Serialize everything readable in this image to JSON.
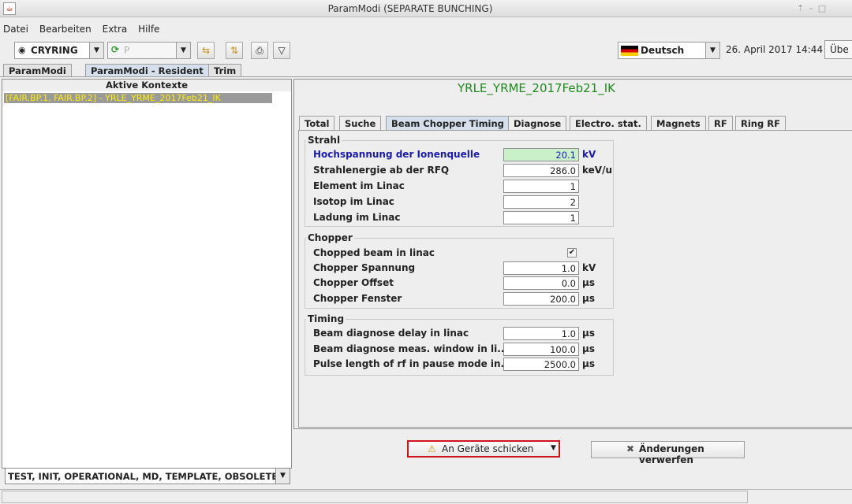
{
  "window": {
    "title": "ParamModi (SEPARATE BUNCHING)"
  },
  "menu": {
    "items": [
      "Datei",
      "Bearbeiten",
      "Extra",
      "Hilfe"
    ]
  },
  "toolbar": {
    "accelerator": "CRYRING",
    "particle": "P",
    "language": "Deutsch",
    "datetime": "26. April 2017 14:44",
    "mode_label": "Übe"
  },
  "main_tabs": [
    "ParamModi",
    "ParamModi - Resident",
    "Trim"
  ],
  "left": {
    "header": "Aktive Kontexte",
    "selected_context": "[FAIR.BP.1, FAIR.BP.2] - YRLE_YRME_2017Feb21_IK",
    "filter": "TEST, INIT, OPERATIONAL, MD, TEMPLATE, OBSOLETE"
  },
  "right": {
    "title": "YRLE_YRME_2017Feb21_IK",
    "tabs": [
      "Total",
      "Suche",
      "Beam Chopper Timing",
      "Diagnose",
      "Electro. stat.",
      "Magnets",
      "RF",
      "Ring RF"
    ],
    "groups": {
      "strahl": {
        "title": "Strahl",
        "fields": [
          {
            "label": "Hochspannung der Ionenquelle",
            "value": "20.1",
            "unit": "kV"
          },
          {
            "label": "Strahlenergie ab der RFQ",
            "value": "286.0",
            "unit": "keV/u"
          },
          {
            "label": "Element im Linac",
            "value": "1",
            "unit": ""
          },
          {
            "label": "Isotop im Linac",
            "value": "2",
            "unit": ""
          },
          {
            "label": "Ladung im Linac",
            "value": "1",
            "unit": ""
          }
        ]
      },
      "chopper": {
        "title": "Chopper",
        "checkbox_label": "Chopped beam in linac",
        "checked": true,
        "fields": [
          {
            "label": "Chopper Spannung",
            "value": "1.0",
            "unit": "kV"
          },
          {
            "label": "Chopper Offset",
            "value": "0.0",
            "unit": "µs"
          },
          {
            "label": "Chopper Fenster",
            "value": "200.0",
            "unit": "µs"
          }
        ]
      },
      "timing": {
        "title": "Timing",
        "fields": [
          {
            "label": "Beam diagnose delay in linac",
            "value": "1.0",
            "unit": "µs"
          },
          {
            "label": "Beam diagnose meas. window in li...",
            "value": "100.0",
            "unit": "µs"
          },
          {
            "label": "Pulse length of rf in pause mode in...",
            "value": "2500.0",
            "unit": "µs"
          }
        ]
      }
    }
  },
  "actions": {
    "send": "An Geräte schicken",
    "discard": "Änderungen verwerfen"
  },
  "colors": {
    "highlight_field": "#c9f0c9",
    "context_title": "#1f8a1f",
    "send_border": "#d0151e"
  }
}
